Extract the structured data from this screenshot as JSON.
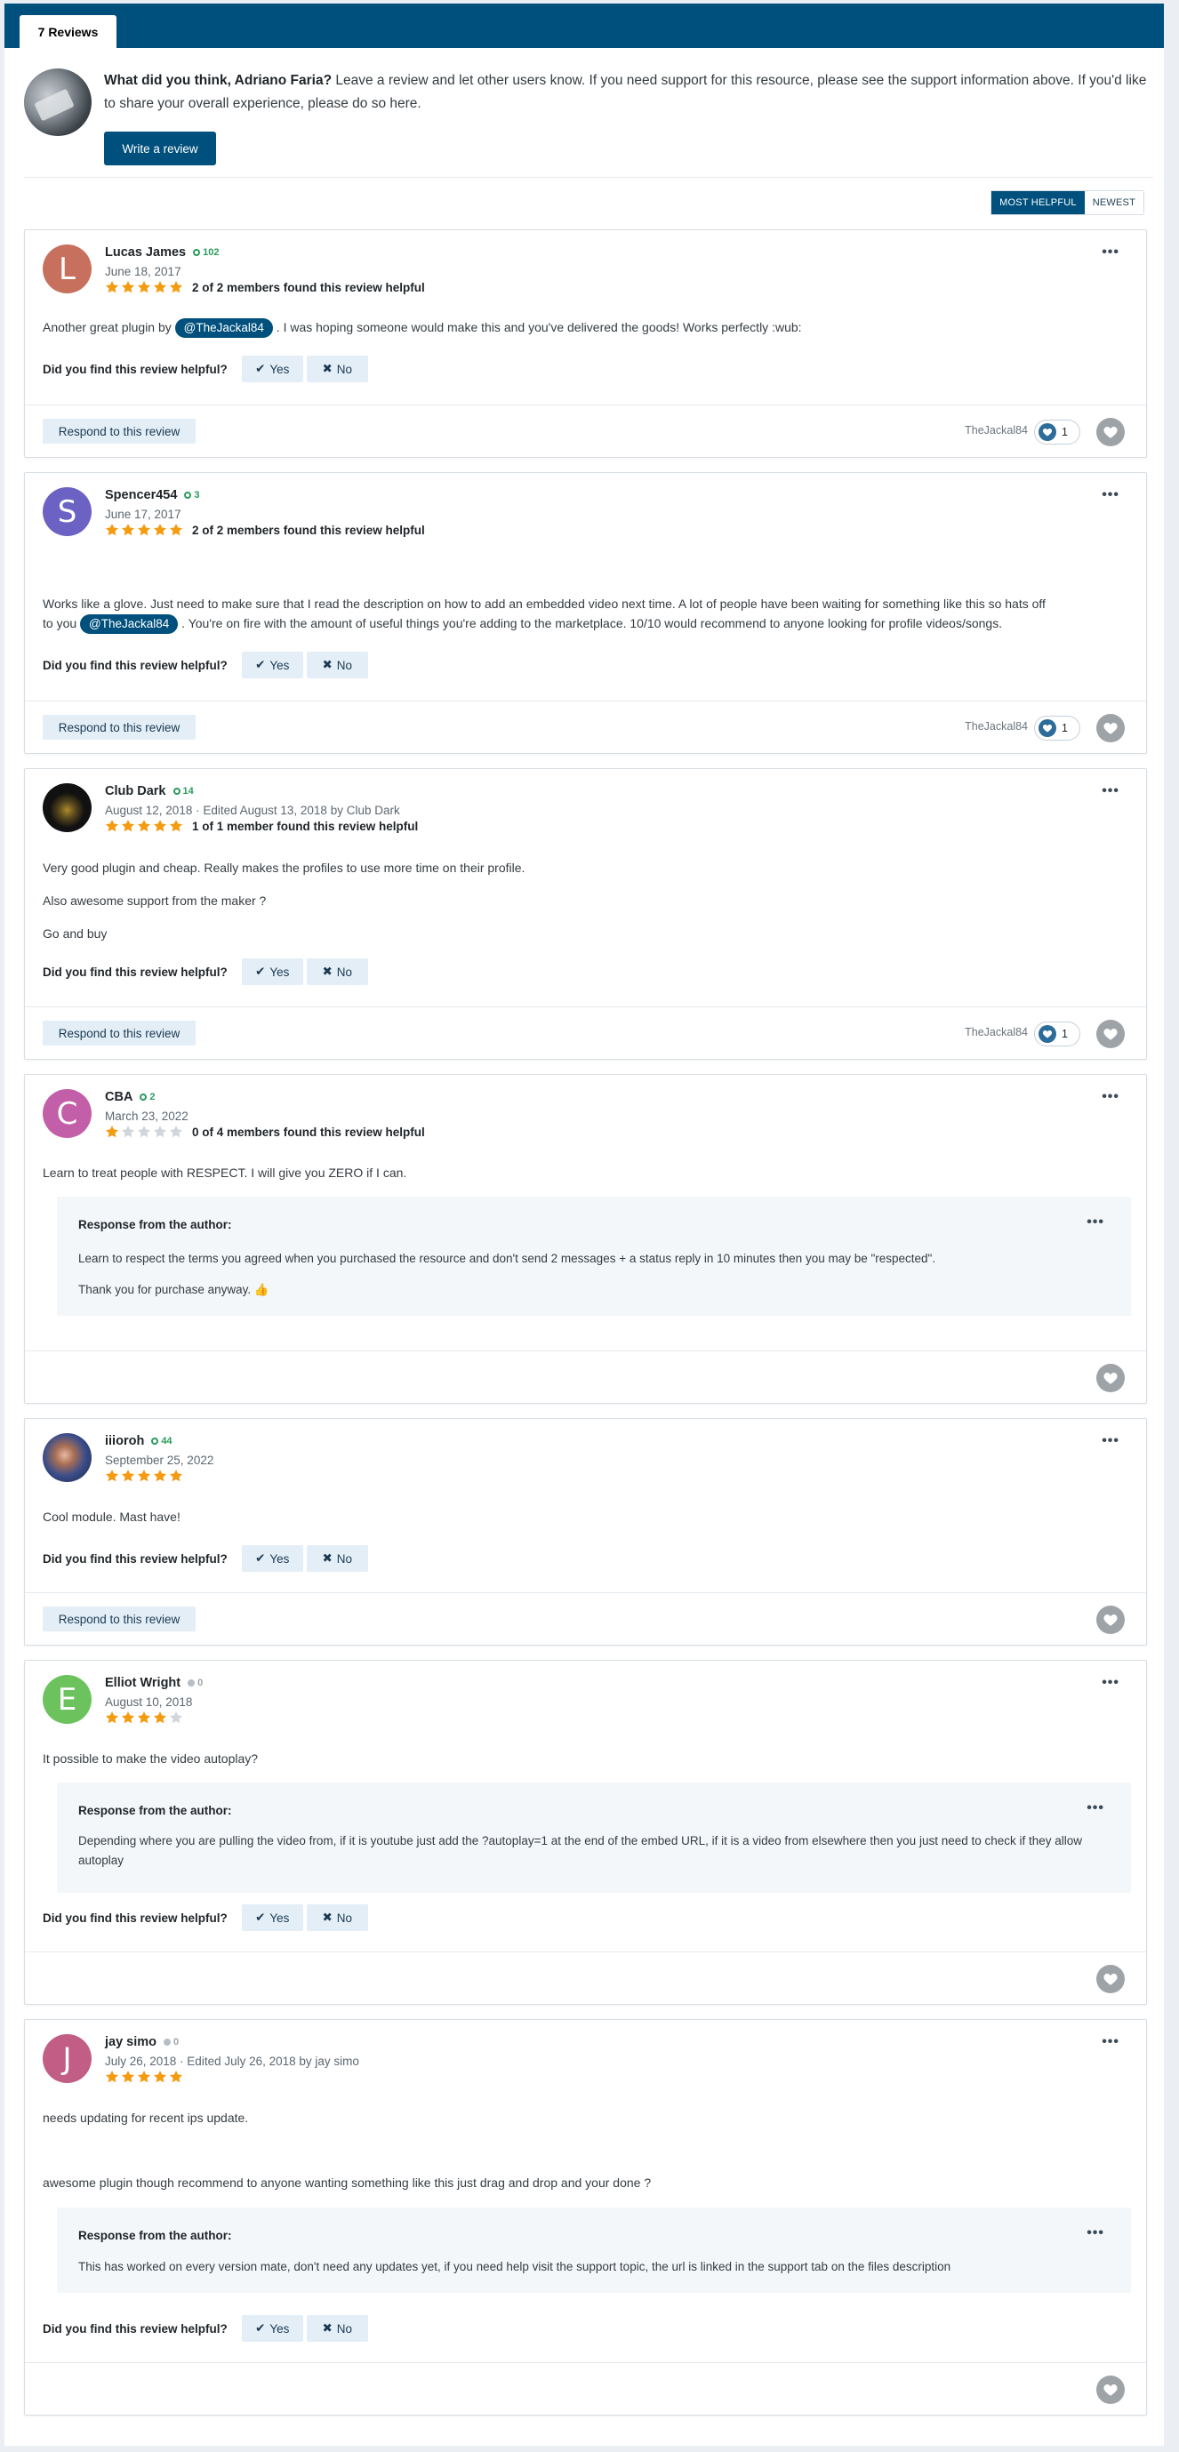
{
  "tab": {
    "label": "7 Reviews"
  },
  "prompt": {
    "bold": "What did you think, Adriano Faria?",
    "text": " Leave a review and let other users know. If you need support for this resource, please see the support information above. If you'd like to share your overall experience, please do so here.",
    "button": "Write a review"
  },
  "sort": {
    "helpful": "MOST HELPFUL",
    "newest": "NEWEST"
  },
  "labels": {
    "helpful_q": "Did you find this review helpful?",
    "yes": "Yes",
    "no": "No",
    "respond": "Respond to this review",
    "response_title": "Response from the author:",
    "more": "•••"
  },
  "colors": {
    "brand": "#00507d",
    "star_on": "#f39c12",
    "star_off": "#d2d6da",
    "rep_positive": "#2a9b5a"
  },
  "reviews": [
    {
      "name": "Lucas James",
      "initial": "L",
      "avatar_color": "#c8705e",
      "rep": "102",
      "date": "June 18, 2017",
      "rating": 5,
      "helpful": "2 of 2 members found this review helpful",
      "body_before": "Another great plugin by ",
      "mention": "@TheJackal84",
      "body_after": " . I was hoping someone would make this and you've delivered the goods! Works perfectly :wub:",
      "reaction_user": "TheJackal84",
      "reaction_count": "1"
    },
    {
      "name": "Spencer454",
      "initial": "S",
      "avatar_color": "#6b62c4",
      "rep": "3",
      "date": "June 17, 2017",
      "rating": 5,
      "helpful": "2 of 2 members found this review helpful",
      "body_line1": "Works like a glove. Just need to make sure that I read the description on how to add an embedded video next time. A lot of people have been waiting for something like this so hats off",
      "body_before": "to you ",
      "mention": "@TheJackal84",
      "body_after": " . You're on fire with the amount of useful things you're adding to the marketplace. 10/10 would recommend to anyone looking for profile videos/songs.",
      "reaction_user": "TheJackal84",
      "reaction_count": "1"
    },
    {
      "name": "Club Dark",
      "rep": "14",
      "date": "August 12, 2018 · Edited August 13, 2018 by Club Dark",
      "rating": 5,
      "helpful": "1 of 1 member found this review helpful",
      "p1": "Very good plugin and cheap. Really makes the profiles to use more time on their profile.",
      "p2": "Also awesome support from the maker ?",
      "p3": "Go and buy",
      "reaction_user": "TheJackal84",
      "reaction_count": "1"
    },
    {
      "name": "CBA",
      "initial": "C",
      "avatar_color": "#c35fa8",
      "rep": "2",
      "date": "March 23, 2022",
      "rating": 1,
      "helpful": "0 of 4 members found this review helpful",
      "body": "Learn to treat people with RESPECT. I will give you ZERO if I can.",
      "response_p1": "Learn to respect the terms you agreed when you purchased the resource and don't send 2 messages + a status reply in 10 minutes then you may be \"respected\".",
      "response_p2": "Thank you for purchase anyway. 👍"
    },
    {
      "name": "iiioroh",
      "rep": "44",
      "date": "September 25, 2022",
      "rating": 5,
      "body": "Cool module. Mast have!"
    },
    {
      "name": "Elliot Wright",
      "initial": "E",
      "avatar_color": "#6cc35e",
      "rep": "0",
      "date": "August 10, 2018",
      "rating": 4,
      "body": "It possible to make the video autoplay?",
      "response_p1": "Depending where you are pulling the video from, if it is youtube just add the ?autoplay=1 at the end of the embed URL, if it is a video from elsewhere then you just need to check if they allow autoplay"
    },
    {
      "name": "jay simo",
      "initial": "J",
      "avatar_color": "#c25d85",
      "rep": "0",
      "date": "July 26, 2018 · Edited July 26, 2018 by jay simo",
      "rating": 5,
      "p1": "needs updating for recent ips update.",
      "p2": "awesome plugin though recommend to anyone wanting something like this just drag and drop and your done ?",
      "response_p1": "This has worked on every version mate, don't need any updates yet, if you need help visit the support topic, the url is linked in the support tab on the files description"
    }
  ]
}
